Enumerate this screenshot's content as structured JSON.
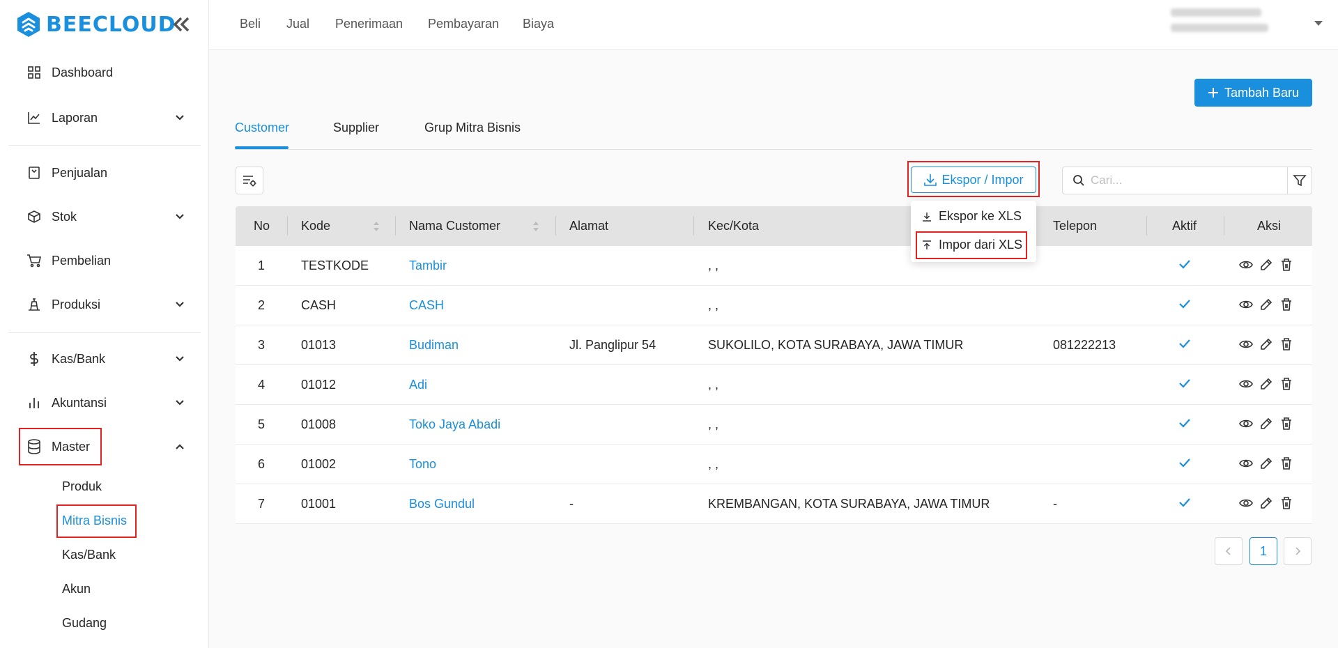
{
  "app": {
    "name": "BEECLOUD",
    "brand_color": "#1a8fdd",
    "highlight_color": "#e32222"
  },
  "sidebar": {
    "items": [
      {
        "label": "Dashboard",
        "icon": "grid-icon"
      },
      {
        "label": "Laporan",
        "icon": "chart-line-icon"
      },
      {
        "label": "Penjualan",
        "icon": "receipt-icon"
      },
      {
        "label": "Stok",
        "icon": "box-icon"
      },
      {
        "label": "Pembelian",
        "icon": "cart-icon"
      },
      {
        "label": "Produksi",
        "icon": "factory-icon"
      },
      {
        "label": "Kas/Bank",
        "icon": "dollar-icon"
      },
      {
        "label": "Akuntansi",
        "icon": "bar-chart-icon"
      },
      {
        "label": "Master",
        "icon": "database-icon"
      }
    ],
    "master_sub": [
      "Produk",
      "Mitra Bisnis",
      "Kas/Bank",
      "Akun",
      "Gudang"
    ],
    "active_sub": "Mitra Bisnis"
  },
  "topnav": {
    "links": [
      "Beli",
      "Jual",
      "Penerimaan",
      "Pembayaran",
      "Biaya"
    ]
  },
  "page": {
    "add_button": "Tambah Baru",
    "tabs": [
      "Customer",
      "Supplier",
      "Grup Mitra Bisnis"
    ],
    "active_tab": "Customer",
    "export_button": "Ekspor / Impor",
    "search_placeholder": "Cari...",
    "dropdown": [
      "Ekspor ke XLS",
      "Impor dari XLS"
    ]
  },
  "table": {
    "columns": [
      "No",
      "Kode",
      "Nama Customer",
      "Alamat",
      "Kec/Kota",
      "Telepon",
      "Aktif",
      "Aksi"
    ],
    "rows": [
      {
        "no": "1",
        "kode": "TESTKODE",
        "nama": "Tambir",
        "alamat": "",
        "kota": ", ,",
        "telepon": ""
      },
      {
        "no": "2",
        "kode": "CASH",
        "nama": "CASH",
        "alamat": "",
        "kota": ", ,",
        "telepon": ""
      },
      {
        "no": "3",
        "kode": "01013",
        "nama": "Budiman",
        "alamat": "Jl. Panglipur 54",
        "kota": "SUKOLILO, KOTA SURABAYA, JAWA TIMUR",
        "telepon": "081222213"
      },
      {
        "no": "4",
        "kode": "01012",
        "nama": "Adi",
        "alamat": "",
        "kota": ", ,",
        "telepon": ""
      },
      {
        "no": "5",
        "kode": "01008",
        "nama": "Toko Jaya Abadi",
        "alamat": "",
        "kota": ", ,",
        "telepon": ""
      },
      {
        "no": "6",
        "kode": "01002",
        "nama": "Tono",
        "alamat": "",
        "kota": ", ,",
        "telepon": ""
      },
      {
        "no": "7",
        "kode": "01001",
        "nama": "Bos Gundul",
        "alamat": "-",
        "kota": "KREMBANGAN, KOTA SURABAYA, JAWA TIMUR",
        "telepon": "-"
      }
    ]
  },
  "pagination": {
    "current": "1"
  }
}
